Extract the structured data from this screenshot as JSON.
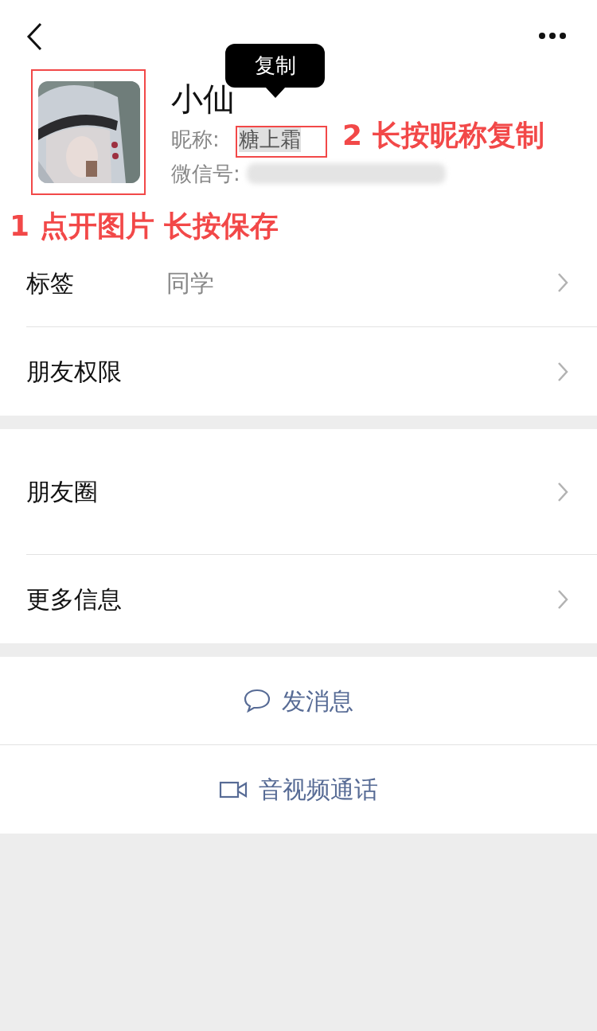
{
  "profile": {
    "name": "小仙",
    "nickname_label": "昵称:",
    "nickname": "糖上霜",
    "wechat_id_label": "微信号:"
  },
  "tooltip": {
    "label": "复制"
  },
  "annotations": [
    {
      "text": "1 点开图片 长按保存",
      "kind": "avatar"
    },
    {
      "text": "2 长按昵称复制",
      "kind": "nickname"
    }
  ],
  "groups": [
    [
      {
        "label": "标签",
        "value": "同学"
      },
      {
        "label": "朋友权限"
      }
    ],
    [
      {
        "label": "朋友圈",
        "kind": "tall"
      },
      {
        "label": "更多信息"
      }
    ]
  ],
  "actions": [
    {
      "label": "发消息",
      "kind": "message"
    },
    {
      "label": "音视频通话",
      "kind": "video"
    }
  ]
}
